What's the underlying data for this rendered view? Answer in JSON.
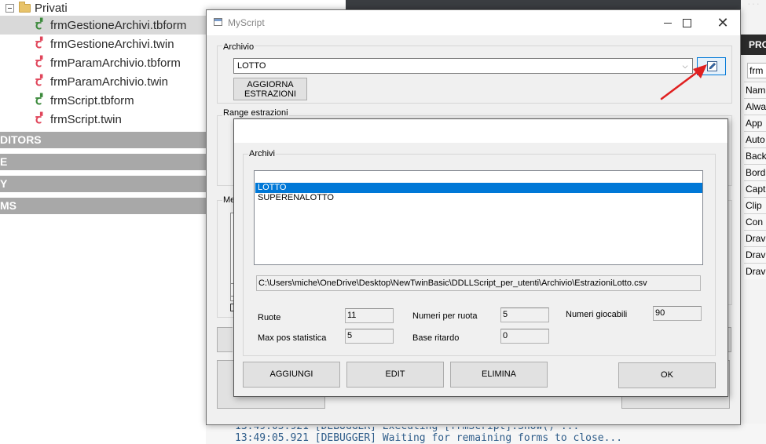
{
  "ide": {
    "folder_label": "Privati",
    "files": [
      {
        "label": "frmGestioneArchivi.tbform",
        "icon_color": "#3c8a3c",
        "selected": true
      },
      {
        "label": "frmGestioneArchivi.twin",
        "icon_color": "#e0455a",
        "selected": false
      },
      {
        "label": "frmParamArchivio.tbform",
        "icon_color": "#e0455a",
        "selected": false
      },
      {
        "label": "frmParamArchivio.twin",
        "icon_color": "#e0455a",
        "selected": false
      },
      {
        "label": "frmScript.tbform",
        "icon_color": "#3c8a3c",
        "selected": false
      },
      {
        "label": "frmScript.twin",
        "icon_color": "#e0455a",
        "selected": false
      }
    ],
    "sections": [
      "DITORS",
      "E",
      "Y",
      "MS"
    ],
    "right_panel": {
      "header": "PRO",
      "object_field": "frm",
      "property_rows": [
        "Nam",
        "Alwa",
        "App",
        "Auto",
        "Back",
        "Bord",
        "Capt",
        "Clip",
        "Con",
        "Drav",
        "Drav",
        "Drav"
      ]
    },
    "console_line": "13:49:05.921  [DEBUGGER] Waiting for remaining forms to close...",
    "console_prev": "13:49:05.921  [DEBUGGER] Executing  [frmScript].Show() ..."
  },
  "window": {
    "title": "MyScript",
    "archivio": {
      "label": "Archivio",
      "selected": "LOTTO",
      "aggiorna_button": "AGGIORNA ESTRAZIONI"
    },
    "range_label": "Range estrazioni",
    "me_label": "Me"
  },
  "dialog": {
    "group_label": "Archivi",
    "list_items": [
      "LOTTO",
      "SUPERENALOTTO"
    ],
    "selected_index": 0,
    "path": "C:\\Users\\miche\\OneDrive\\Desktop\\NewTwinBasic\\DDLLScript_per_utenti\\Archivio\\EstrazioniLotto.csv",
    "fields": {
      "ruote": {
        "label": "Ruote",
        "value": "11"
      },
      "max_pos": {
        "label": "Max pos statistica",
        "value": "5"
      },
      "numeri_per_ruota": {
        "label": "Numeri per ruota",
        "value": "5"
      },
      "base_ritardo": {
        "label": "Base ritardo",
        "value": "0"
      },
      "numeri_giocabili": {
        "label": "Numeri giocabili",
        "value": "90"
      }
    },
    "buttons": {
      "aggiungi": "AGGIUNGI",
      "edit": "EDIT",
      "elimina": "ELIMINA",
      "ok": "OK"
    }
  },
  "colors": {
    "selection": "#0078d7",
    "arrow": "#e02020",
    "tree_selected": "#d9d9d9",
    "section_header": "#a8a8a8"
  }
}
